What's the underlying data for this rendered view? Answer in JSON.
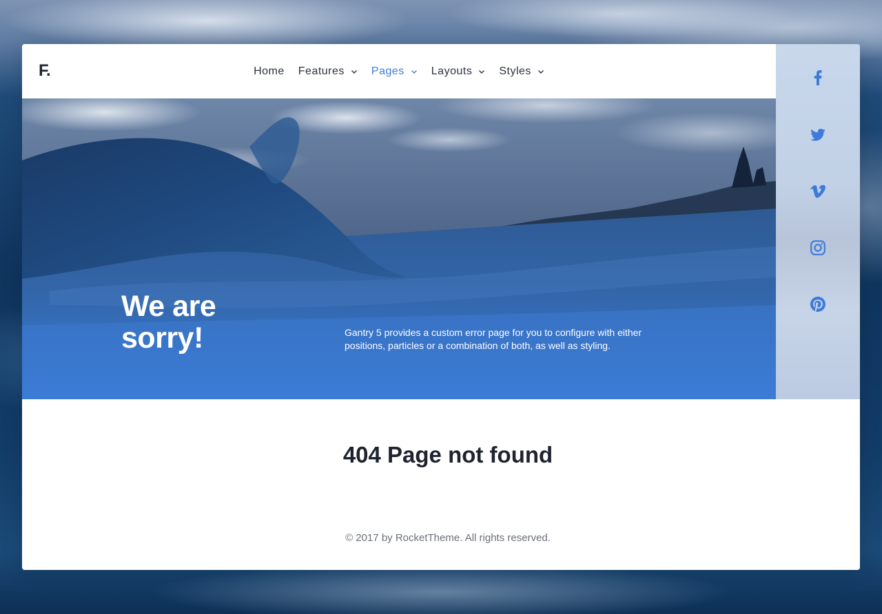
{
  "brand": {
    "logo_text": "F."
  },
  "nav": {
    "items": [
      {
        "label": "Home",
        "has_dropdown": false,
        "active": false
      },
      {
        "label": "Features",
        "has_dropdown": true,
        "active": false
      },
      {
        "label": "Pages",
        "has_dropdown": true,
        "active": true
      },
      {
        "label": "Layouts",
        "has_dropdown": true,
        "active": false
      },
      {
        "label": "Styles",
        "has_dropdown": true,
        "active": false
      }
    ]
  },
  "hero": {
    "title": "We are\nsorry!",
    "description": "Gantry 5 provides a custom error page for you to configure with either positions, particles or a combination of both, as well as styling."
  },
  "social": {
    "icons": [
      "facebook-icon",
      "twitter-icon",
      "vimeo-icon",
      "instagram-icon",
      "pinterest-icon"
    ],
    "icon_color": "#3e7bd9"
  },
  "content": {
    "error_title": "404 Page not found",
    "copyright": "© 2017 by RocketTheme. All rights reserved."
  },
  "colors": {
    "accent": "#3e7bd9",
    "text_dark": "#1f2330",
    "text_muted": "#6b6f7a"
  }
}
